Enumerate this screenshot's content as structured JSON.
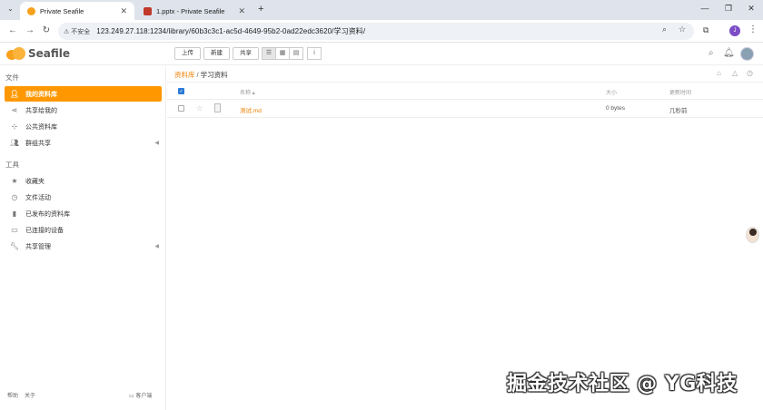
{
  "browser": {
    "tabs": [
      {
        "title": "Private Seafile",
        "active": true
      },
      {
        "title": "1.pptx - Private Seafile",
        "active": false
      }
    ],
    "security_label": "不安全",
    "url": "123.249.27.118:1234/library/60b3c3c1-ac5d-4649-95b2-0ad22edc3620/学习资料/",
    "profile_initial": "J"
  },
  "app": {
    "logo_text": "Seafile",
    "toolbar": {
      "upload": "上传",
      "new": "新建",
      "share": "共享"
    },
    "sidebar": {
      "files_heading": "文件",
      "files_items": [
        {
          "label": "我的资料库",
          "icon": "user-icon",
          "active": true
        },
        {
          "label": "共享给我的",
          "icon": "share-icon",
          "active": false
        },
        {
          "label": "公共资料库",
          "icon": "org-icon",
          "active": false
        },
        {
          "label": "群组共享",
          "icon": "group-icon",
          "active": false
        }
      ],
      "tools_heading": "工具",
      "tools_items": [
        {
          "label": "收藏夹",
          "icon": "star-icon"
        },
        {
          "label": "文件活动",
          "icon": "clock-icon"
        },
        {
          "label": "已发布的资料库",
          "icon": "book-icon"
        },
        {
          "label": "已连接的设备",
          "icon": "monitor-icon"
        },
        {
          "label": "共享管理",
          "icon": "wrench-icon"
        }
      ],
      "footer": {
        "help": "帮助",
        "about": "关于",
        "client": "客户端"
      }
    },
    "breadcrumb": {
      "library": "资料库",
      "separator": "/",
      "current": "学习资料"
    },
    "table": {
      "headers": {
        "name": "名称 ▴",
        "size": "大小",
        "modified": "更新时间"
      },
      "rows": [
        {
          "name": "测试.md",
          "size": "0 bytes",
          "modified": "几秒前"
        }
      ]
    }
  },
  "watermark": "掘金技术社区 @ YG科技"
}
